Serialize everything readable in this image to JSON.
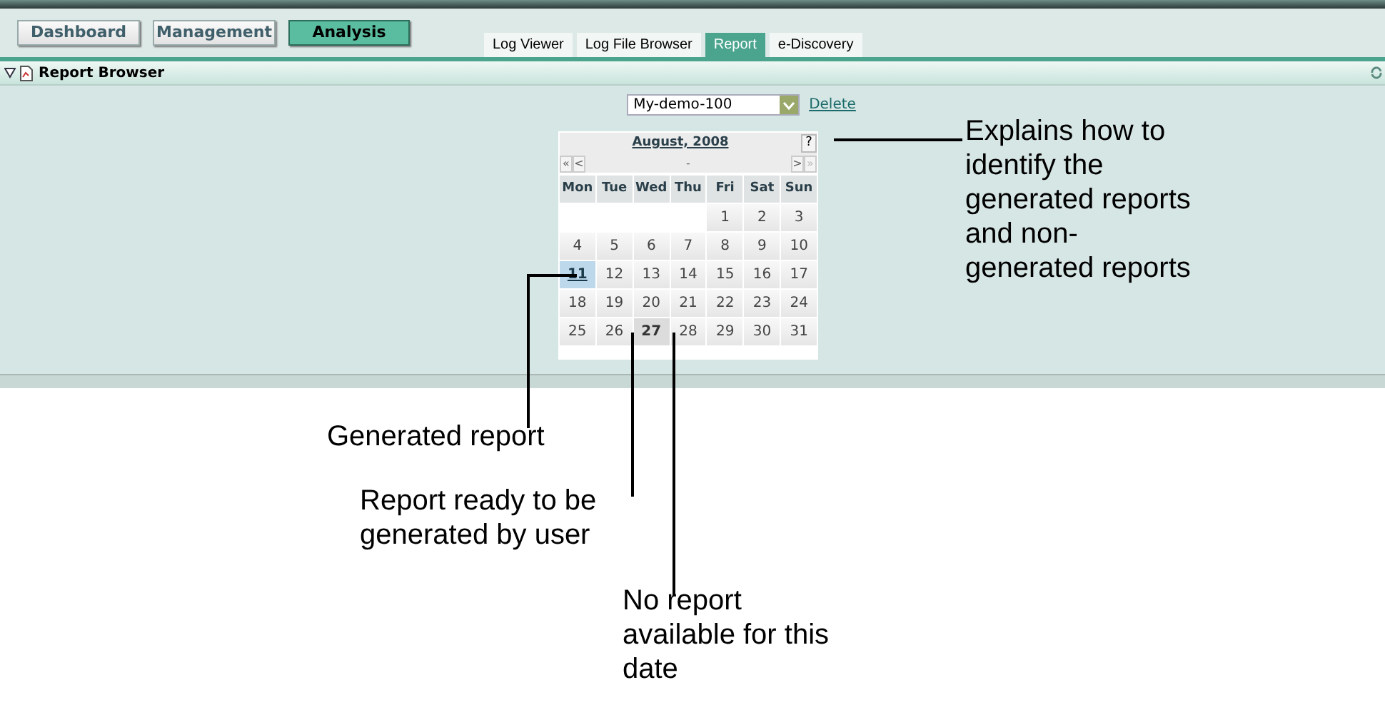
{
  "nav_buttons": [
    {
      "label": "Dashboard",
      "selected": false
    },
    {
      "label": "Management",
      "selected": false
    },
    {
      "label": "Analysis",
      "selected": true
    }
  ],
  "tabs": [
    {
      "label": "Log Viewer",
      "selected": false
    },
    {
      "label": "Log File Browser",
      "selected": false
    },
    {
      "label": "Report",
      "selected": true
    },
    {
      "label": "e-Discovery",
      "selected": false
    }
  ],
  "panel": {
    "title": "Report Browser",
    "expanded": true
  },
  "report_select": {
    "value": "My-demo-100"
  },
  "delete_link": "Delete",
  "calendar": {
    "month": "August, 2008",
    "help": "?",
    "first": "«",
    "prev": "<",
    "middle": "-",
    "next": ">",
    "last": "»",
    "weekdays": [
      "Mon",
      "Tue",
      "Wed",
      "Thu",
      "Fri",
      "Sat",
      "Sun"
    ],
    "weeks": [
      [
        {
          "kind": "blank"
        },
        {
          "kind": "blank"
        },
        {
          "kind": "blank"
        },
        {
          "kind": "blank"
        },
        {
          "label": "1",
          "kind": "normal"
        },
        {
          "label": "2",
          "kind": "normal"
        },
        {
          "label": "3",
          "kind": "normal"
        }
      ],
      [
        {
          "label": "4",
          "kind": "normal"
        },
        {
          "label": "5",
          "kind": "normal"
        },
        {
          "label": "6",
          "kind": "normal"
        },
        {
          "label": "7",
          "kind": "normal"
        },
        {
          "label": "8",
          "kind": "normal"
        },
        {
          "label": "9",
          "kind": "normal"
        },
        {
          "label": "10",
          "kind": "normal"
        }
      ],
      [
        {
          "label": "11",
          "kind": "generated"
        },
        {
          "label": "12",
          "kind": "normal"
        },
        {
          "label": "13",
          "kind": "normal"
        },
        {
          "label": "14",
          "kind": "normal"
        },
        {
          "label": "15",
          "kind": "normal"
        },
        {
          "label": "16",
          "kind": "normal"
        },
        {
          "label": "17",
          "kind": "normal"
        }
      ],
      [
        {
          "label": "18",
          "kind": "normal"
        },
        {
          "label": "19",
          "kind": "normal"
        },
        {
          "label": "20",
          "kind": "normal"
        },
        {
          "label": "21",
          "kind": "normal"
        },
        {
          "label": "22",
          "kind": "normal"
        },
        {
          "label": "23",
          "kind": "normal"
        },
        {
          "label": "24",
          "kind": "normal"
        }
      ],
      [
        {
          "label": "25",
          "kind": "normal"
        },
        {
          "label": "26",
          "kind": "normal"
        },
        {
          "label": "27",
          "kind": "current"
        },
        {
          "label": "28",
          "kind": "normal"
        },
        {
          "label": "29",
          "kind": "normal"
        },
        {
          "label": "30",
          "kind": "normal"
        },
        {
          "label": "31",
          "kind": "normal"
        }
      ]
    ]
  },
  "callouts": [
    "Explains how to\nidentify the\ngenerated reports\nand non-\ngenerated reports",
    "Generated report",
    "Report ready to be\ngenerated by user",
    "No report\navailable for this\ndate"
  ]
}
